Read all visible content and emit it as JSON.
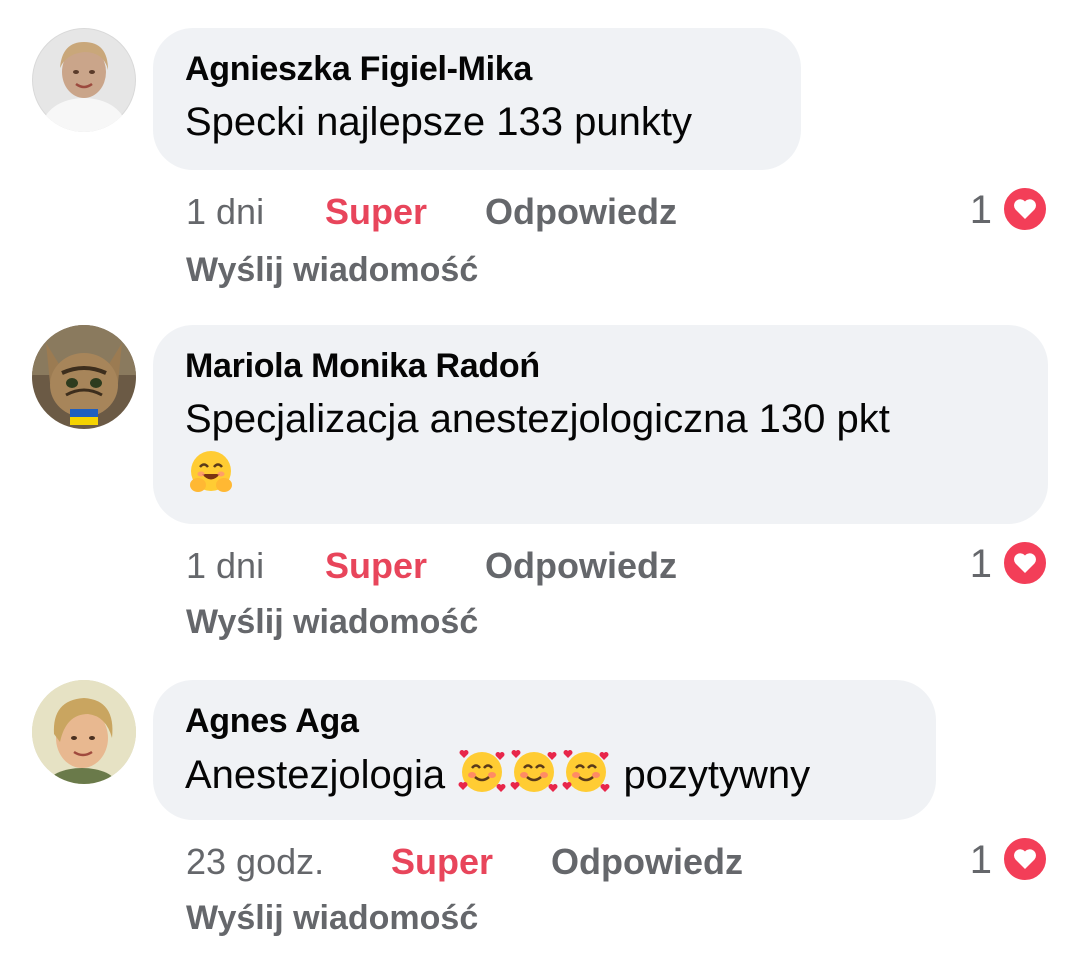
{
  "comments": [
    {
      "author": "Agnieszka Figiel-Mika",
      "text": "Specki najlepsze 133 punkty",
      "time": "1 dni",
      "like_label": "Super",
      "reply_label": "Odpowiedz",
      "send_label": "Wyślij wiadomość",
      "reaction_count": "1",
      "reaction_icon": "heart-icon"
    },
    {
      "author": "Mariola Monika Radoń",
      "text": "Specjalizacja anestezjologiczna 130 pkt",
      "text_emoji": "hugging-face-emoji",
      "time": "1 dni",
      "like_label": "Super",
      "reply_label": "Odpowiedz",
      "send_label": "Wyślij wiadomość",
      "reaction_count": "1",
      "reaction_icon": "heart-icon"
    },
    {
      "author": "Agnes Aga",
      "text_before": "Anestezjologia",
      "text_emojis": [
        "smiling-face-with-hearts-emoji",
        "smiling-face-with-hearts-emoji",
        "smiling-face-with-hearts-emoji"
      ],
      "text_after": "pozytywny",
      "time": "23 godz.",
      "like_label": "Super",
      "reply_label": "Odpowiedz",
      "send_label": "Wyślij wiadomość",
      "reaction_count": "1",
      "reaction_icon": "heart-icon"
    }
  ],
  "colors": {
    "super_red": "#e8455b",
    "secondary_text": "#65676b",
    "bubble_bg": "#f0f2f5",
    "heart_red": "#f33e58"
  }
}
